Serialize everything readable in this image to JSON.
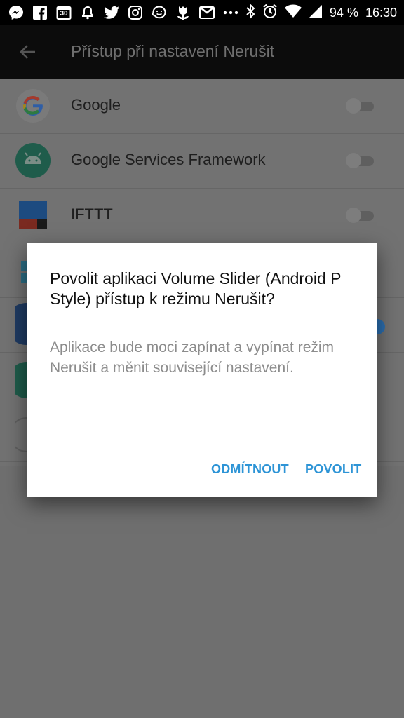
{
  "status_bar": {
    "icons": [
      "messenger-icon",
      "facebook-icon",
      "calendar-icon",
      "bell-icon",
      "twitter-icon",
      "instagram-icon",
      "waze-icon",
      "tulip-icon",
      "gmail-icon",
      "more-dots-icon",
      "bluetooth-icon",
      "alarm-icon",
      "wifi-icon",
      "signal-icon"
    ],
    "calendar_day": "30",
    "battery": "94 %",
    "time": "16:30"
  },
  "app_bar": {
    "title": "Přístup při nastavení Nerušit",
    "back_icon": "back-arrow-icon"
  },
  "list": [
    {
      "label": "Google",
      "icon": "google-icon",
      "enabled": false
    },
    {
      "label": "Google Services Framework",
      "icon": "android-icon",
      "enabled": false
    },
    {
      "label": "IFTTT",
      "icon": "ifttt-icon",
      "enabled": false
    }
  ],
  "dialog": {
    "title": "Povolit aplikaci Volume Slider (Android P Style) přístup k režimu Nerušit?",
    "body": "Aplikace bude moci zapínat a vypínat režim Nerušit a měnit související nastavení.",
    "deny_label": "ODMÍTNOUT",
    "allow_label": "POVOLIT"
  },
  "colors": {
    "accent": "#2d94d6",
    "scrim": "#6f6f6f",
    "appbar": "#0c0c0c"
  }
}
